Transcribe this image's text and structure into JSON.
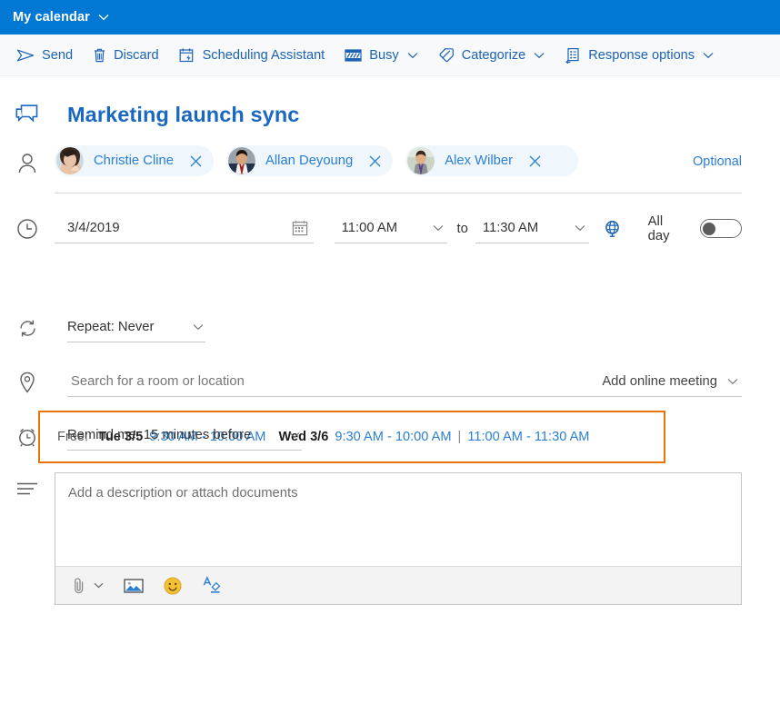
{
  "titlebar": {
    "label": "My calendar",
    "chevron_icon": "chevron-down-icon",
    "bg": "#0078d4"
  },
  "commandbar": {
    "items": [
      {
        "label": "Send",
        "icon": "send-icon",
        "has_chevron": false
      },
      {
        "label": "Discard",
        "icon": "trash-icon",
        "has_chevron": false
      },
      {
        "label": "Scheduling Assistant",
        "icon": "scheduling-assistant-icon",
        "has_chevron": false
      },
      {
        "label": "Busy",
        "icon": "busy-status-icon",
        "has_chevron": true
      },
      {
        "label": "Categorize",
        "icon": "tag-icon",
        "has_chevron": true
      },
      {
        "label": "Response options",
        "icon": "response-options-icon",
        "has_chevron": true
      }
    ],
    "link_color": "#1b62b3"
  },
  "event": {
    "title": "Marketing launch sync",
    "title_icon": "chat-bubbles-icon",
    "title_color": "#1b68c0"
  },
  "attendees": {
    "people_icon": "person-icon",
    "optional_label": "Optional",
    "remove_icon": "close-icon",
    "list": [
      {
        "name": "Christie Cline",
        "avatar": "avatar-christie-cline"
      },
      {
        "name": "Allan Deyoung",
        "avatar": "avatar-allan-deyoung"
      },
      {
        "name": "Alex Wilber",
        "avatar": "avatar-alex-wilber"
      }
    ]
  },
  "datetime": {
    "clock_icon": "clock-icon",
    "date_value": "3/4/2019",
    "calendar_icon": "calendar-icon",
    "start_time": "11:00 AM",
    "to_label": "to",
    "end_time": "11:30 AM",
    "timezone_icon": "globe-icon",
    "all_day_label": "All day",
    "all_day_on": false
  },
  "suggestions": {
    "border_color": "#e8730c",
    "free_label": "Free:",
    "slots": [
      {
        "day": "Tue 3/5",
        "times": [
          "9:30 AM - 10:00 AM"
        ]
      },
      {
        "day": "Wed 3/6",
        "times": [
          "9:30 AM - 10:00 AM",
          "11:00 AM - 11:30 AM"
        ]
      }
    ],
    "separator": "|"
  },
  "repeat": {
    "icon": "repeat-icon",
    "label": "Repeat: Never",
    "chevron_icon": "chevron-down-icon"
  },
  "location": {
    "icon": "location-pin-icon",
    "placeholder": "Search for a room or location",
    "online_meeting_label": "Add online meeting",
    "chevron_icon": "chevron-down-icon"
  },
  "reminder": {
    "icon": "alarm-clock-icon",
    "label": "Remind me: 15 minutes before",
    "chevron_icon": "chevron-down-icon"
  },
  "description": {
    "icon": "description-lines-icon",
    "placeholder": "Add a description or attach documents",
    "tools": [
      {
        "icon": "paperclip-icon",
        "has_chevron": true
      },
      {
        "icon": "picture-icon",
        "has_chevron": false
      },
      {
        "icon": "emoji-icon",
        "has_chevron": false
      },
      {
        "icon": "text-highlight-icon",
        "has_chevron": false
      }
    ]
  }
}
